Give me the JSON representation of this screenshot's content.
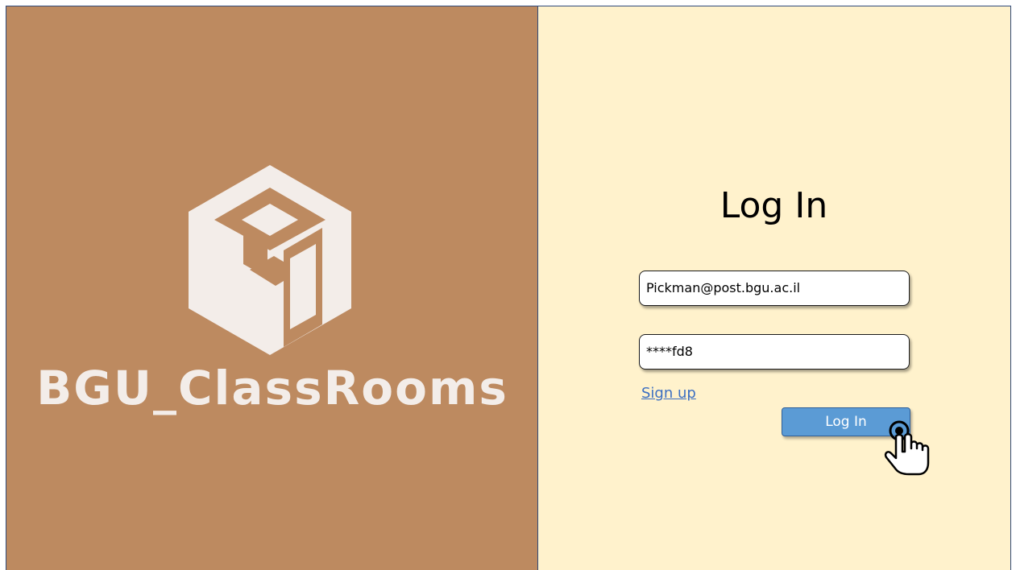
{
  "brand": {
    "name": "BGU_ClassRooms",
    "logo_icon": "isometric-cube-logo-icon"
  },
  "login": {
    "title": "Log In",
    "email_value": "Pickman@post.bgu.ac.il",
    "password_value": "****fd8",
    "signup_label": "Sign up",
    "login_button_label": "Log In",
    "cursor_icon": "hand-pointer-icon"
  },
  "colors": {
    "brand_panel": "#bd8a60",
    "login_panel": "#fff2cc",
    "button": "#5b9bd5",
    "link": "#3c6fc2",
    "logo": "#f3ede9"
  }
}
